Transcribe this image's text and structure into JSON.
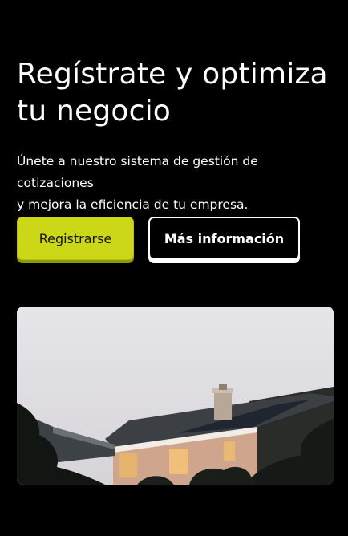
{
  "hero": {
    "title_line1": "Regístrate y optimiza",
    "title_line2": "tu negocio",
    "subtitle_line1": "Únete a nuestro sistema de gestión de cotizaciones",
    "subtitle_line2": "y mejora la eficiencia de tu empresa."
  },
  "buttons": {
    "primary_label": "Registrarse",
    "secondary_label": "Más información"
  },
  "colors": {
    "background": "#000000",
    "accent": "#ccd817",
    "text": "#ffffff"
  }
}
